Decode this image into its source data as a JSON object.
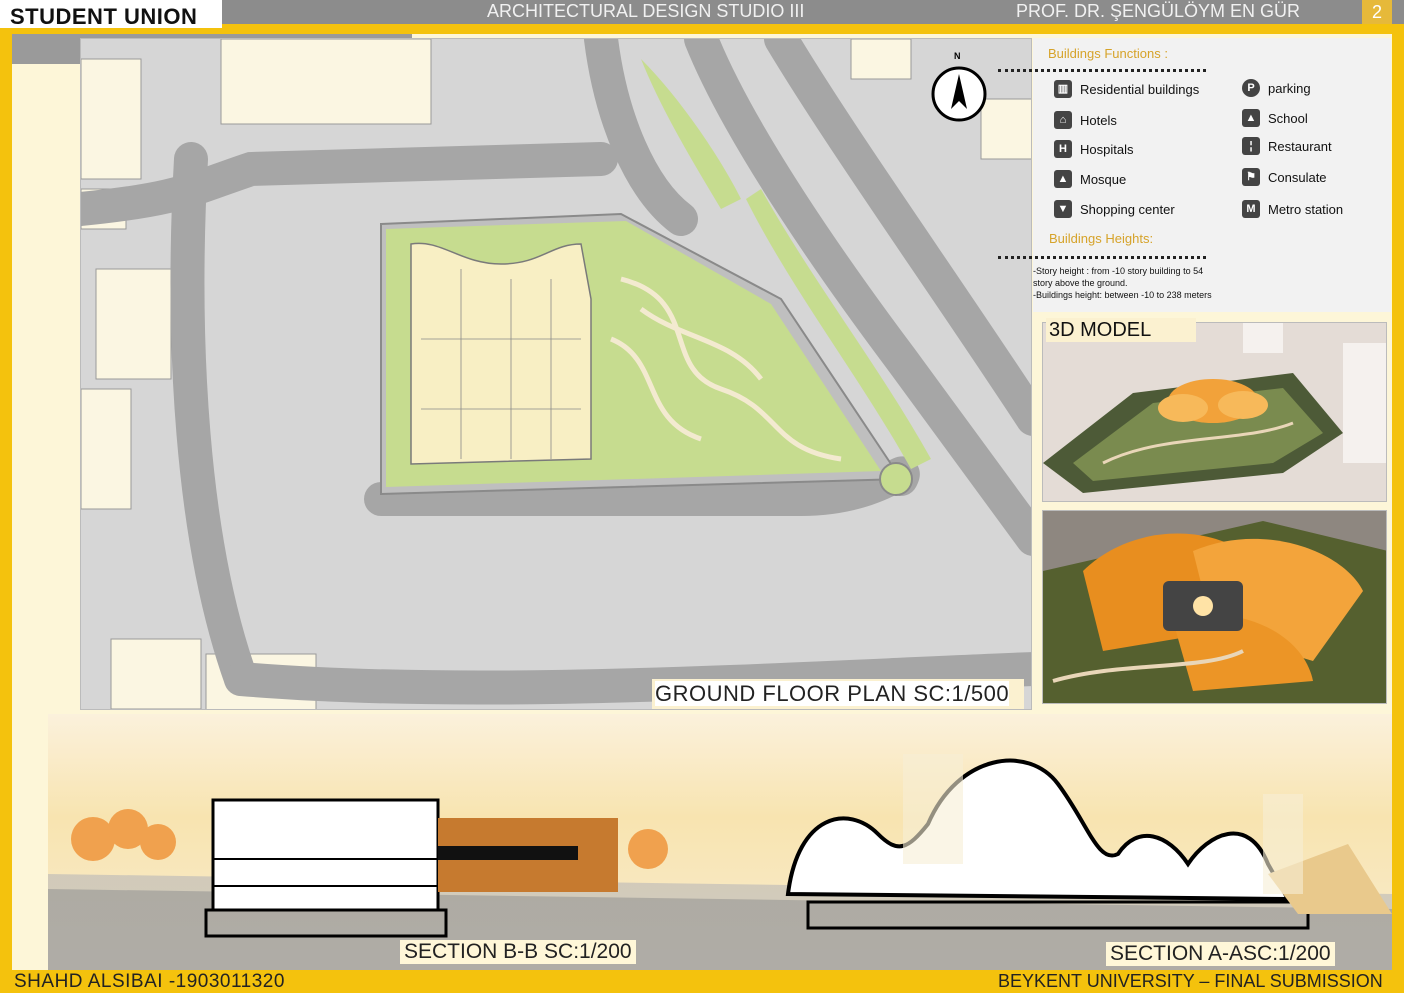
{
  "header": {
    "title": "STUDENT UNION",
    "studio": "ARCHITECTURAL DESIGN STUDIO III",
    "professor": "PROF. DR. ŞENGÜLÖYM EN GÜR",
    "page_number": "2"
  },
  "plan": {
    "label": "GROUND FLOOR PLAN   SC:1/500",
    "north_label": "N"
  },
  "legend": {
    "functions_heading": "Buildings Functions :",
    "items_left": [
      {
        "icon": "residential-buildings-icon",
        "label": "Residential buildings"
      },
      {
        "icon": "hotel-icon",
        "label": "Hotels"
      },
      {
        "icon": "hospital-icon",
        "label": "Hospitals"
      },
      {
        "icon": "mosque-icon",
        "label": "Mosque"
      },
      {
        "icon": "shopping-cart-icon",
        "label": "Shopping center"
      }
    ],
    "items_right": [
      {
        "icon": "parking-icon",
        "label": "parking"
      },
      {
        "icon": "school-icon",
        "label": "School"
      },
      {
        "icon": "restaurant-icon",
        "label": "Restaurant"
      },
      {
        "icon": "flag-icon",
        "label": "Consulate"
      },
      {
        "icon": "metro-icon",
        "label": "Metro station"
      }
    ],
    "heights_heading": "Buildings Heights:",
    "notes": [
      "-Story height : from -10 story building to 54",
      "story above the ground.",
      "-Buildings height: between -10 to 238 meters"
    ]
  },
  "model": {
    "label": "3D MODEL"
  },
  "sections": {
    "bb_label": "SECTION B-B SC:1/200",
    "aa_label": "SECTION A-ASC:1/200"
  },
  "footer": {
    "author": "SHAHD ALSIBAI -1903011320",
    "university": "BEYKENT UNIVERSITY – FINAL SUBMISSION"
  },
  "colors": {
    "accent": "#f4c20d",
    "header_gray": "#8c8c8c",
    "label_heading": "#d6a32a",
    "green": "#c6dc8f",
    "building": "#f8f2d9",
    "road": "#a8a8a8"
  }
}
